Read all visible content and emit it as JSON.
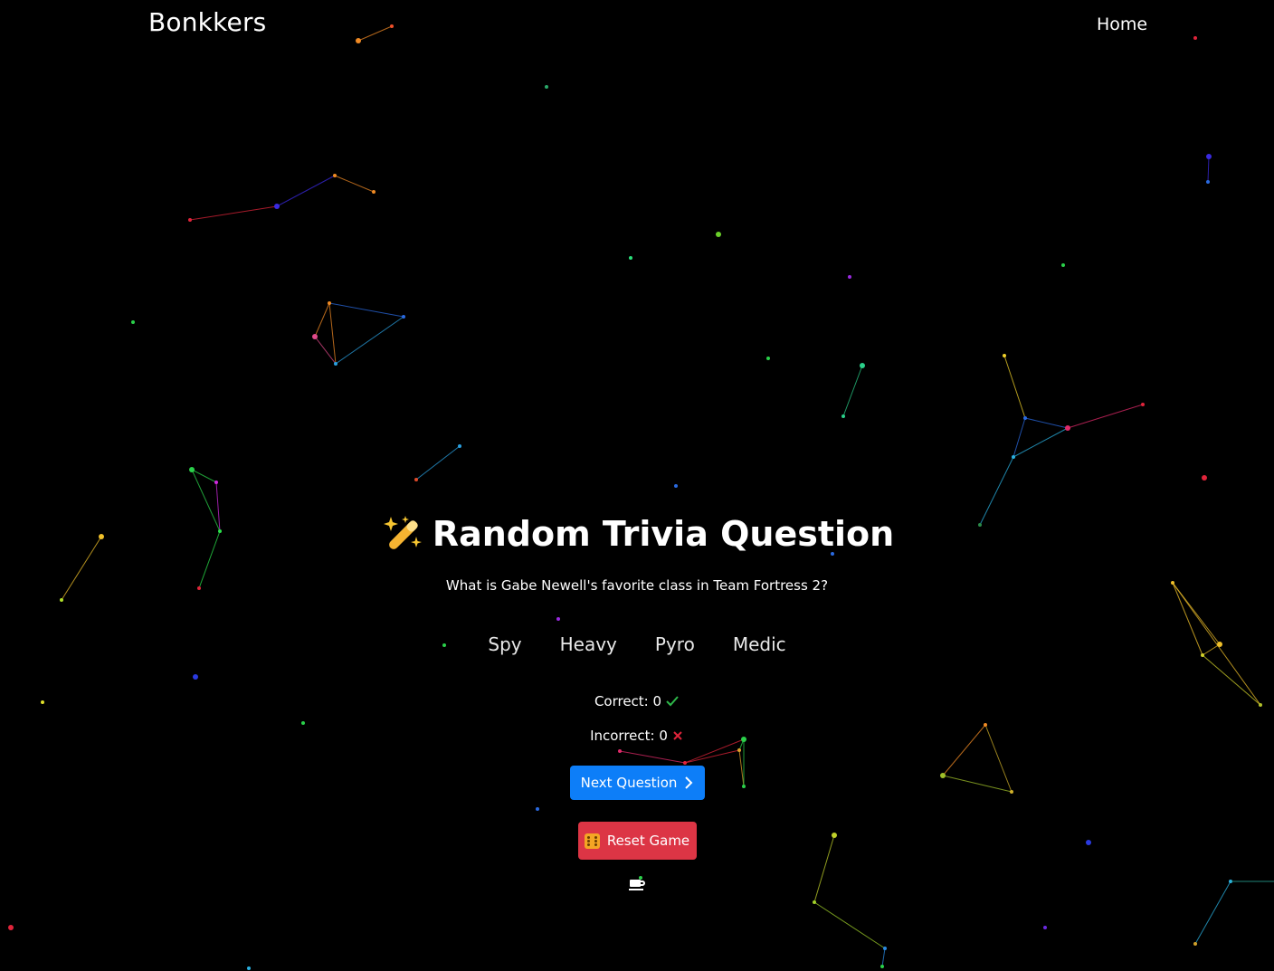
{
  "nav": {
    "brand": "Bonkkers",
    "links": [
      "Home"
    ]
  },
  "trivia": {
    "title": "Random Trivia Question",
    "title_icon": "magic-wand-icon",
    "question": "What is Gabe Newell's favorite class in Team Fortress 2?",
    "answers": [
      "Spy",
      "Heavy",
      "Pyro",
      "Medic"
    ]
  },
  "score": {
    "correct_label": "Correct: 0",
    "correct_icon": "checkmark-icon",
    "incorrect_label": "Incorrect: 0",
    "incorrect_icon": "x-mark-icon"
  },
  "buttons": {
    "next_label": "Next Question",
    "next_icon": "chevron-right-icon",
    "reset_label": "Reset Game",
    "reset_icon": "dice-icon",
    "footer_icon": "coffee-cup-icon"
  },
  "colors": {
    "background": "#000000",
    "next_button": "#0d7ef8",
    "reset_button": "#dc3545",
    "correct_check": "#2eb84a",
    "incorrect_x": "#e0243a"
  }
}
